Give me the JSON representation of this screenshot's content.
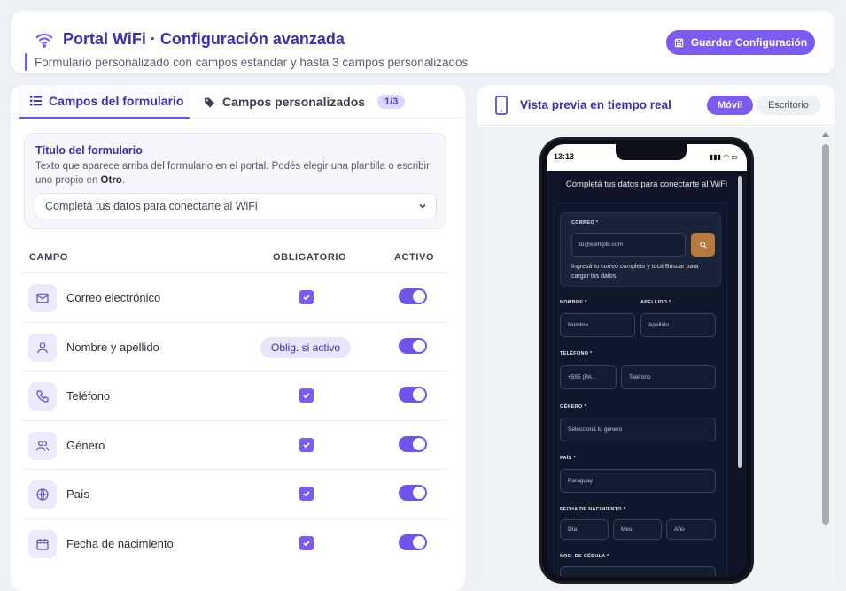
{
  "header": {
    "title": "Portal WiFi · Configuración avanzada",
    "subtitle": "Formulario personalizado con campos estándar y hasta 3 campos personalizados",
    "save_label": "Guardar Configuración",
    "accent_color": "#7c5cf0"
  },
  "tabs": [
    {
      "label": "Campos del formulario",
      "icon": "list-icon",
      "active": true
    },
    {
      "label": "Campos personalizados",
      "icon": "tag-icon",
      "count": "1/3",
      "active": false
    }
  ],
  "form_title": {
    "label": "Título del formulario",
    "description_prefix": "Texto que aparece arriba del formulario en el portal. Podés elegir una plantilla o escribir uno propio en ",
    "description_bold": "Otro",
    "description_suffix": ".",
    "selected": "Completá tus datos para conectarte al WiFi"
  },
  "table": {
    "headers": {
      "field": "CAMPO",
      "required": "OBLIGATORIO",
      "active": "ACTIVO"
    },
    "rows": [
      {
        "name": "Correo electrónico",
        "icon": "mail-icon",
        "required": "checked",
        "active": true
      },
      {
        "name": "Nombre y apellido",
        "icon": "user-icon",
        "required": "Oblig. si activo",
        "active": true
      },
      {
        "name": "Teléfono",
        "icon": "phone-icon",
        "required": "checked",
        "active": true
      },
      {
        "name": "Género",
        "icon": "users-icon",
        "required": "checked",
        "active": true
      },
      {
        "name": "País",
        "icon": "globe-icon",
        "required": "checked",
        "active": true
      },
      {
        "name": "Fecha de nacimiento",
        "icon": "calendar-icon",
        "required": "checked",
        "active": true
      }
    ]
  },
  "preview": {
    "title": "Vista previa en tiempo real",
    "mode_mobile": "Móvil",
    "mode_desktop": "Escritorio",
    "status_time": "13:13",
    "heading": "Completá tus datos para conectarte al WiFi",
    "email_label": "CORREO *",
    "email_placeholder": "tú@ejemplo.com",
    "email_help": "Ingresá tu correo completo y tocá Buscar para cargar tus datos.",
    "name_label": "NOMBRE *",
    "name_placeholder": "Nombre",
    "last_label": "APELLIDO *",
    "last_placeholder": "Apellido",
    "phone_label": "TELÉFONO *",
    "phone_code": "+595 (PA...",
    "phone_placeholder": "Teléfono",
    "gender_label": "GÉNERO *",
    "gender_placeholder": "Seleccioná tu género",
    "country_label": "PAÍS *",
    "country_value": "Paraguay",
    "birth_label": "FECHA DE NACIMIENTO *",
    "day": "Día",
    "month": "Mes",
    "year": "Año",
    "id_label": "NRO. DE CÉDULA *"
  }
}
